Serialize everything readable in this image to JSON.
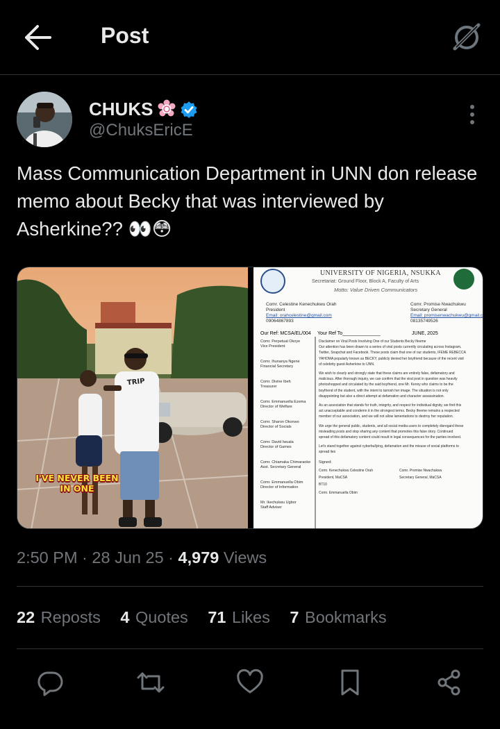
{
  "header": {
    "title": "Post",
    "back_icon": "arrow-left-icon",
    "grok_icon": "grok-icon"
  },
  "author": {
    "display_name": "CHUKS",
    "handle": "@ChuksEricE",
    "badges": [
      "flower-badge-icon",
      "verified-badge-icon"
    ],
    "verified_color": "#1d9bf0"
  },
  "tweet": {
    "text": "Mass Communication Department in UNN don release memo about Becky that was interviewed by Asherkine?? 👀😳"
  },
  "media": {
    "photo_caption": "I'VE NEVER BEEN IN ONE",
    "shirt_text": "TRIP",
    "memo": {
      "university": "UNIVERSITY OF NIGERIA, NSUKKA",
      "secretariat": "Secretariat: Ground Floor, Block A, Faculty of Arts",
      "motto": "Motto: Value Driven Communicators",
      "our_ref": "Our Ref: MCSA/EL/004",
      "your_ref": "Your Ref To______________",
      "date": "JUNE, 2025",
      "left_names": [
        "Comr. Celestine Kenechukwu Orah",
        "President",
        "Email: orahcelestine@gmail.com",
        "09064867893"
      ],
      "right_names": [
        "Comr. Promise Nwachukwu",
        "Secretary General",
        "Email: promisenwachukwu@gmail.com",
        "08135749526"
      ],
      "officers": [
        [
          "Comr. Perpetual Okoye",
          "Vice President"
        ],
        [
          "Comr. Ihunanya Ngene",
          "Financial Secretary"
        ],
        [
          "Comr. Divine Ibeh",
          "Treasurer"
        ],
        [
          "Comr. Emmanuella Ezema",
          "Director of Welfare"
        ],
        [
          "Comr. Sharon Okonwo",
          "Director of Socials"
        ],
        [
          "Comr. David Iwuala",
          "Director of Games"
        ],
        [
          "Comr. Chiamaka Chimaraoke",
          "Asst. Secretary General"
        ],
        [
          "Comr. Emmanuella Obim",
          "Director of Information"
        ],
        [
          "Mr. Ikechukwu Ugbor",
          "Staff Adviser"
        ]
      ],
      "body": [
        "Disclaimer on Viral Posts Involving One of our Students Becky Ifeeme",
        "Our attention has been drawn to a series of viral posts currently circulating across Instagram,",
        "Twitter, Snapchat and Facebook. These posts claim that one of our students, IFEME REBECCA",
        "YAHOMA popularly known as BECKY, publicly denied her boyfriend because of the recent visit",
        "of celebrity guest Asherkine to UNN.",
        "We wish to clearly and strongly state that these claims are entirely false, defamatory and",
        "malicious. After thorough inquiry, we can confirm that the viral post in question was heavily",
        "photoshopped and circulated by the said boyfriend, one Mr. Kenny who claims to be the",
        "boyfriend of the student, with the intent to tarnish her image. The situation is not only",
        "disappointing but also a direct attempt at defamation and character assassination.",
        "As an association that stands for truth, integrity, and respect for individual dignity, we find this",
        "act unacceptable and condemn it in the strongest terms. Becky Ifeeme remains a respected",
        "member of our association, and we will not allow lamentations to destroy her reputation.",
        "We urge the general public, students, and all social media users to completely disregard these",
        "misleading posts and stop sharing any content that promotes this false story. Continued",
        "spread of this defamatory content could result in legal consequences for the parties involved.",
        "Let's stand together against cyberbullying, defamation and the misuse of social platforms to",
        "spread lies"
      ],
      "signed": "Signed:",
      "sign_left": [
        "Comr. Kenechukwu Celestine Orah",
        "President, MaCSA",
        "BT10"
      ],
      "sign_right": [
        "Comr. Promise Nwachukwu",
        "Secretary General, MaCSA"
      ],
      "sign_extra": "Comr. Emmanuella Obim"
    }
  },
  "meta": {
    "time": "2:50 PM",
    "date": "28 Jun 25",
    "views": "4,979",
    "views_label": "Views"
  },
  "stats": [
    {
      "count": "22",
      "label": "Reposts"
    },
    {
      "count": "4",
      "label": "Quotes"
    },
    {
      "count": "71",
      "label": "Likes"
    },
    {
      "count": "7",
      "label": "Bookmarks"
    }
  ],
  "actions": [
    "reply-icon",
    "repost-icon",
    "like-icon",
    "bookmark-icon",
    "share-icon"
  ]
}
